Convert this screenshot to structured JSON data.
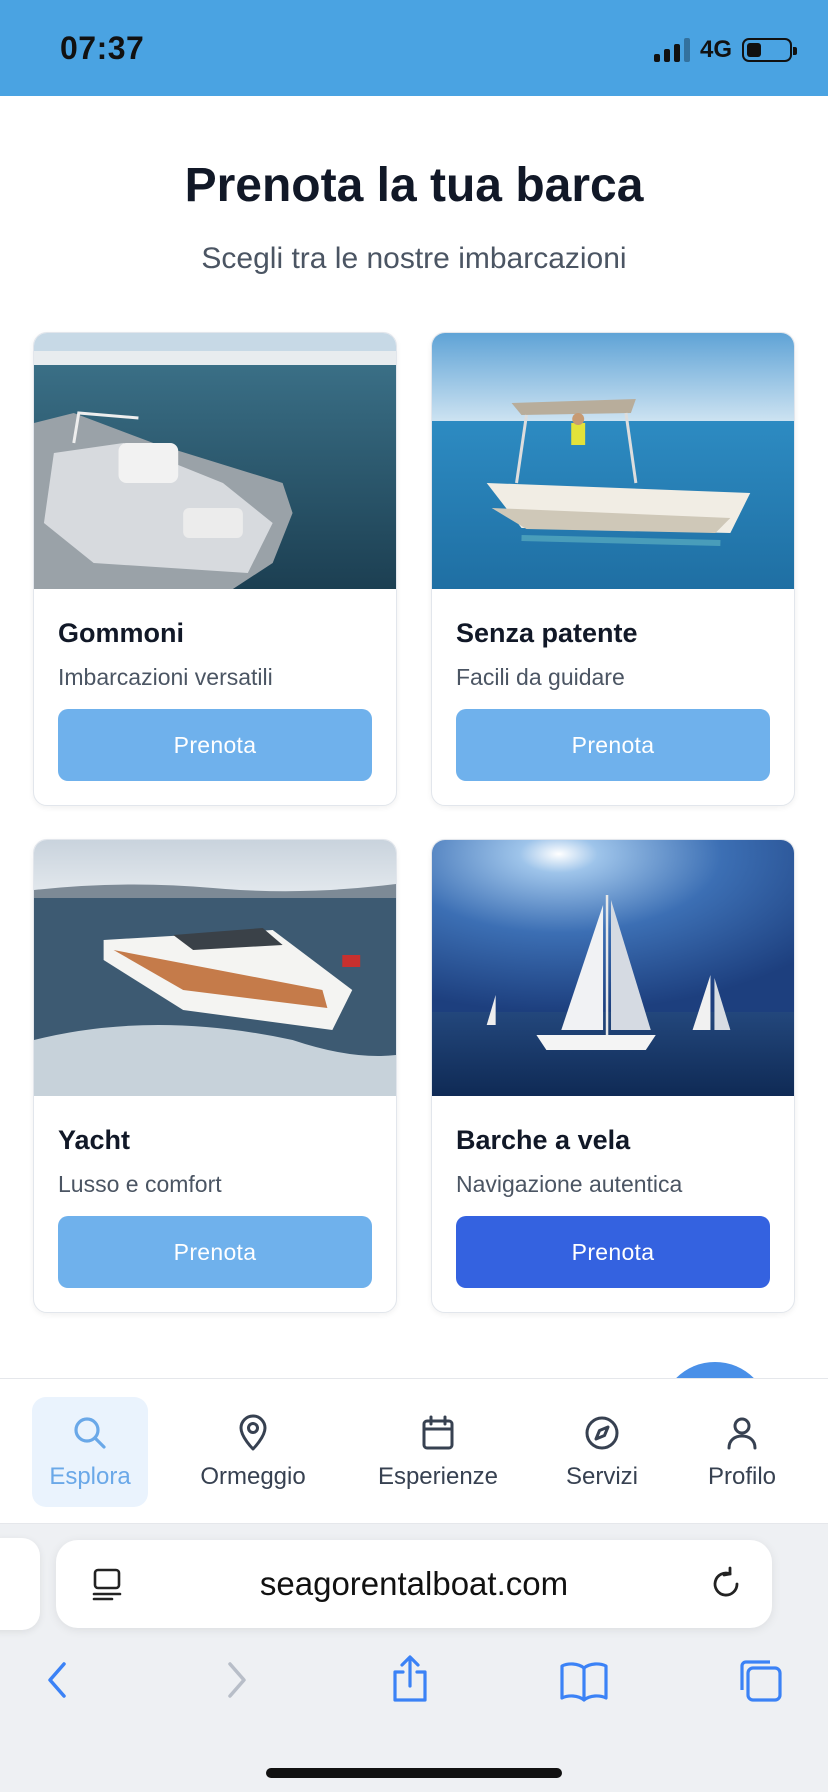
{
  "status_bar": {
    "time": "07:37",
    "network": "4G",
    "battery_level": 0.35
  },
  "header": {
    "title": "Prenota la tua barca",
    "subtitle": "Scegli tra le nostre imbarcazioni"
  },
  "cards": [
    {
      "title": "Gommoni",
      "description": "Imbarcazioni versatili",
      "button": "Prenota"
    },
    {
      "title": "Senza patente",
      "description": "Facili da guidare",
      "button": "Prenota"
    },
    {
      "title": "Yacht",
      "description": "Lusso e comfort",
      "button": "Prenota"
    },
    {
      "title": "Barche a vela",
      "description": "Navigazione autentica",
      "button": "Prenota"
    }
  ],
  "bottom_nav": {
    "items": [
      {
        "label": "Esplora",
        "icon": "search-icon",
        "active": true
      },
      {
        "label": "Ormeggio",
        "icon": "map-pin-icon"
      },
      {
        "label": "Esperienze",
        "icon": "calendar-icon"
      },
      {
        "label": "Servizi",
        "icon": "compass-icon"
      },
      {
        "label": "Profilo",
        "icon": "user-icon"
      }
    ]
  },
  "browser": {
    "url": "seagorentalboat.com"
  },
  "colors": {
    "status_bar": "#4aa3e2",
    "button": "#6fb1ec",
    "button_active": "#3462e0",
    "nav_active": "#6aa8e8"
  }
}
